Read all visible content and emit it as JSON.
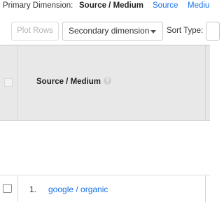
{
  "primary_dimension": {
    "label": "Primary Dimension:",
    "selected": "Source / Medium",
    "options": [
      "Source",
      "Mediu"
    ]
  },
  "toolbar": {
    "plot_rows": "Plot Rows",
    "secondary_dimension": "Secondary dimension",
    "sort_type_label": "Sort Type:"
  },
  "table": {
    "column_header": "Source / Medium",
    "help_glyph": "?",
    "rows": [
      {
        "index": "1.",
        "value": "google / organic"
      }
    ]
  },
  "colors": {
    "link": "#1a73e8",
    "header_bg": "#e8e8e8",
    "disabled_text": "#b4b4b4"
  },
  "icons": {
    "dropdown": "chevron-down-icon",
    "help": "help-circle-icon"
  }
}
